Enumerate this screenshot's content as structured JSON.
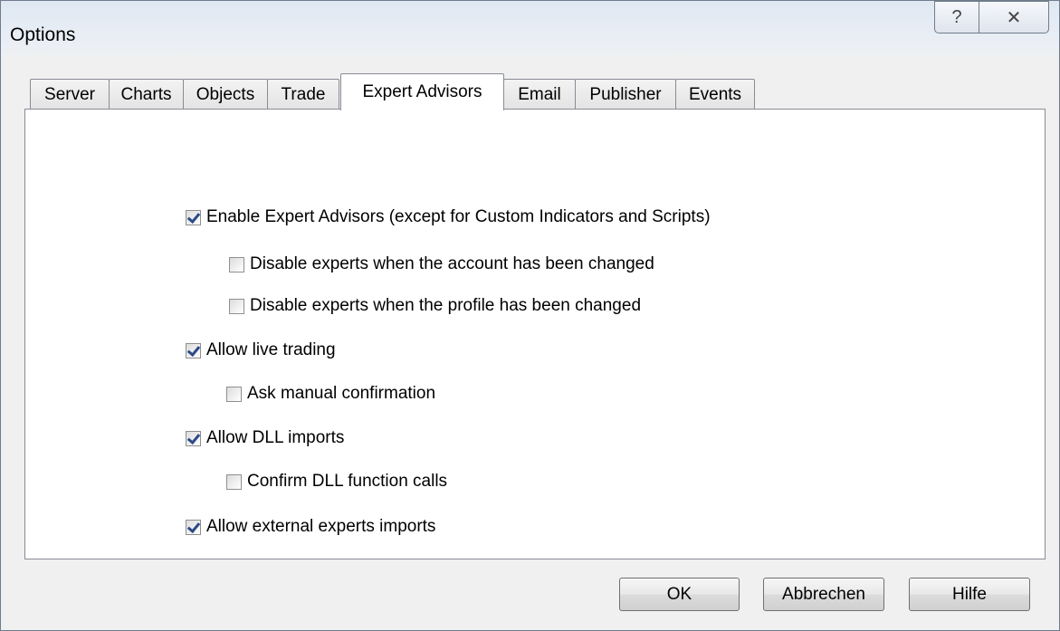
{
  "window": {
    "title": "Options",
    "help_glyph": "?",
    "close_glyph": "✕"
  },
  "tabs": [
    {
      "label": "Server"
    },
    {
      "label": "Charts"
    },
    {
      "label": "Objects"
    },
    {
      "label": "Trade"
    },
    {
      "label": "Expert Advisors",
      "active": true
    },
    {
      "label": "Email"
    },
    {
      "label": "Publisher"
    },
    {
      "label": "Events"
    }
  ],
  "options": [
    {
      "label": "Enable Expert Advisors (except for Custom Indicators and Scripts)",
      "checked": true
    },
    {
      "label": "Disable experts when the account has been changed",
      "checked": false
    },
    {
      "label": "Disable experts when the profile has been changed",
      "checked": false
    },
    {
      "label": "Allow live trading",
      "checked": true
    },
    {
      "label": "Ask manual confirmation",
      "checked": false
    },
    {
      "label": "Allow DLL imports",
      "checked": true
    },
    {
      "label": "Confirm DLL function calls",
      "checked": false
    },
    {
      "label": "Allow external experts imports",
      "checked": true
    }
  ],
  "buttons": {
    "ok": "OK",
    "cancel": "Abbrechen",
    "help": "Hilfe"
  }
}
